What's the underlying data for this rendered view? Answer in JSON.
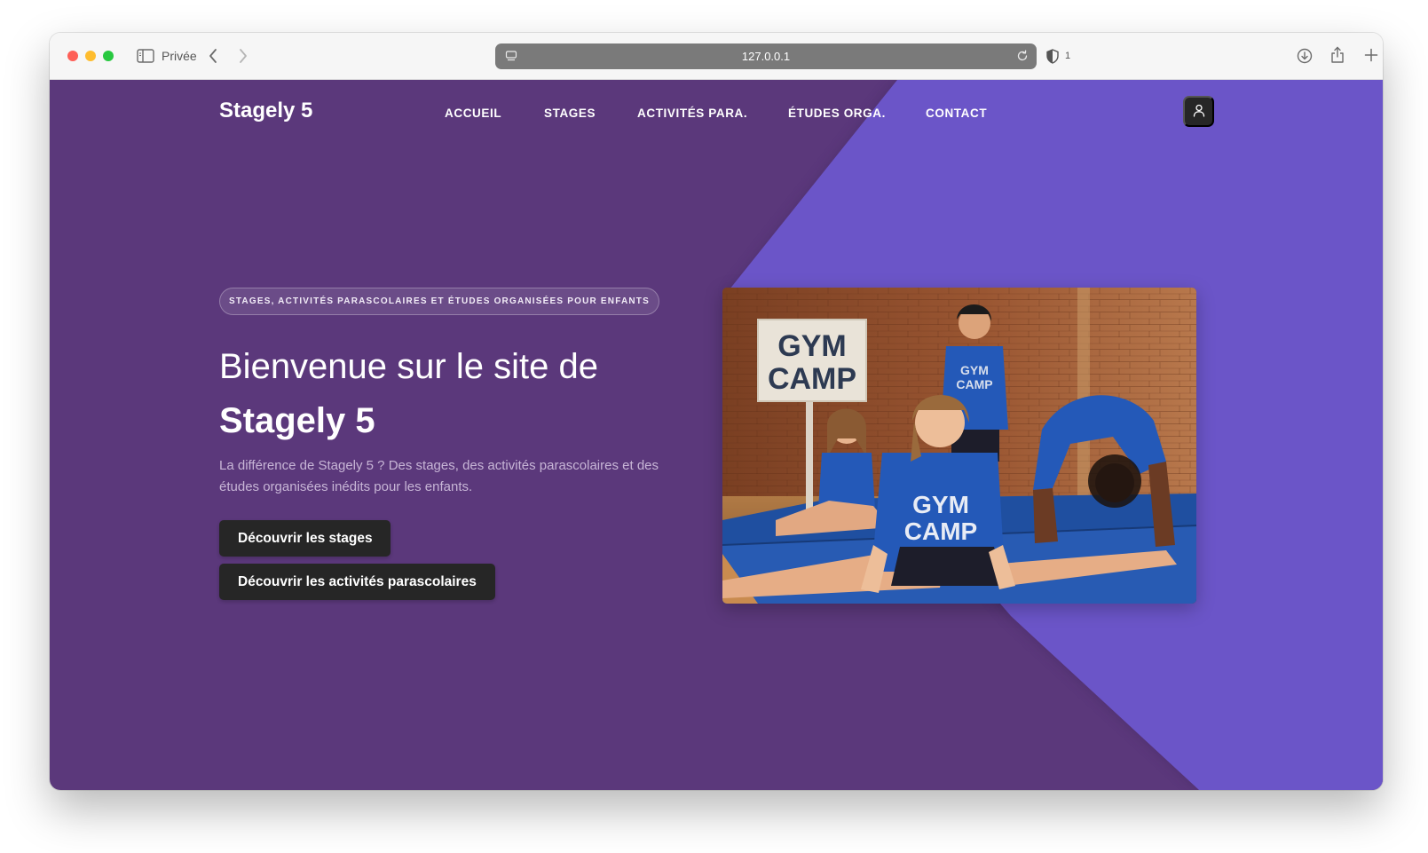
{
  "browser": {
    "private_label": "Privée",
    "url": "127.0.0.1",
    "blocked_count": "1",
    "icons": [
      "sidebar-icon",
      "back-icon",
      "forward-icon",
      "site-icon",
      "reload-icon",
      "shield-icon",
      "download-icon",
      "share-icon",
      "plus-icon",
      "tabs-icon"
    ]
  },
  "site": {
    "brand": "Stagely 5",
    "nav": [
      {
        "label": "ACCUEIL"
      },
      {
        "label": "STAGES"
      },
      {
        "label": "ACTIVITÉS PARA."
      },
      {
        "label": "ÉTUDES ORGA."
      },
      {
        "label": "CONTACT"
      }
    ],
    "user_icon": "user-icon"
  },
  "hero": {
    "eyebrow": "STAGES, ACTIVITÉS PARASCOLAIRES ET ÉTUDES ORGANISÉES POUR ENFANTS",
    "title_line1": "Bienvenue sur le site de",
    "title_line2": "Stagely 5",
    "lede": "La différence de Stagely 5 ? Des stages, des activités parascolaires et des études organisées inédits pour les enfants.",
    "cta_stages": "Découvrir les stages",
    "cta_activites": "Découvrir les activités parascolaires",
    "image": {
      "sign_line1": "GYM",
      "sign_line2": "CAMP",
      "shirt_line1": "GYM",
      "shirt_line2": "CAMP"
    }
  },
  "colors": {
    "page_bg": "#5b387b",
    "accent_shape": "#6b55c8",
    "button_bg": "#262626"
  }
}
